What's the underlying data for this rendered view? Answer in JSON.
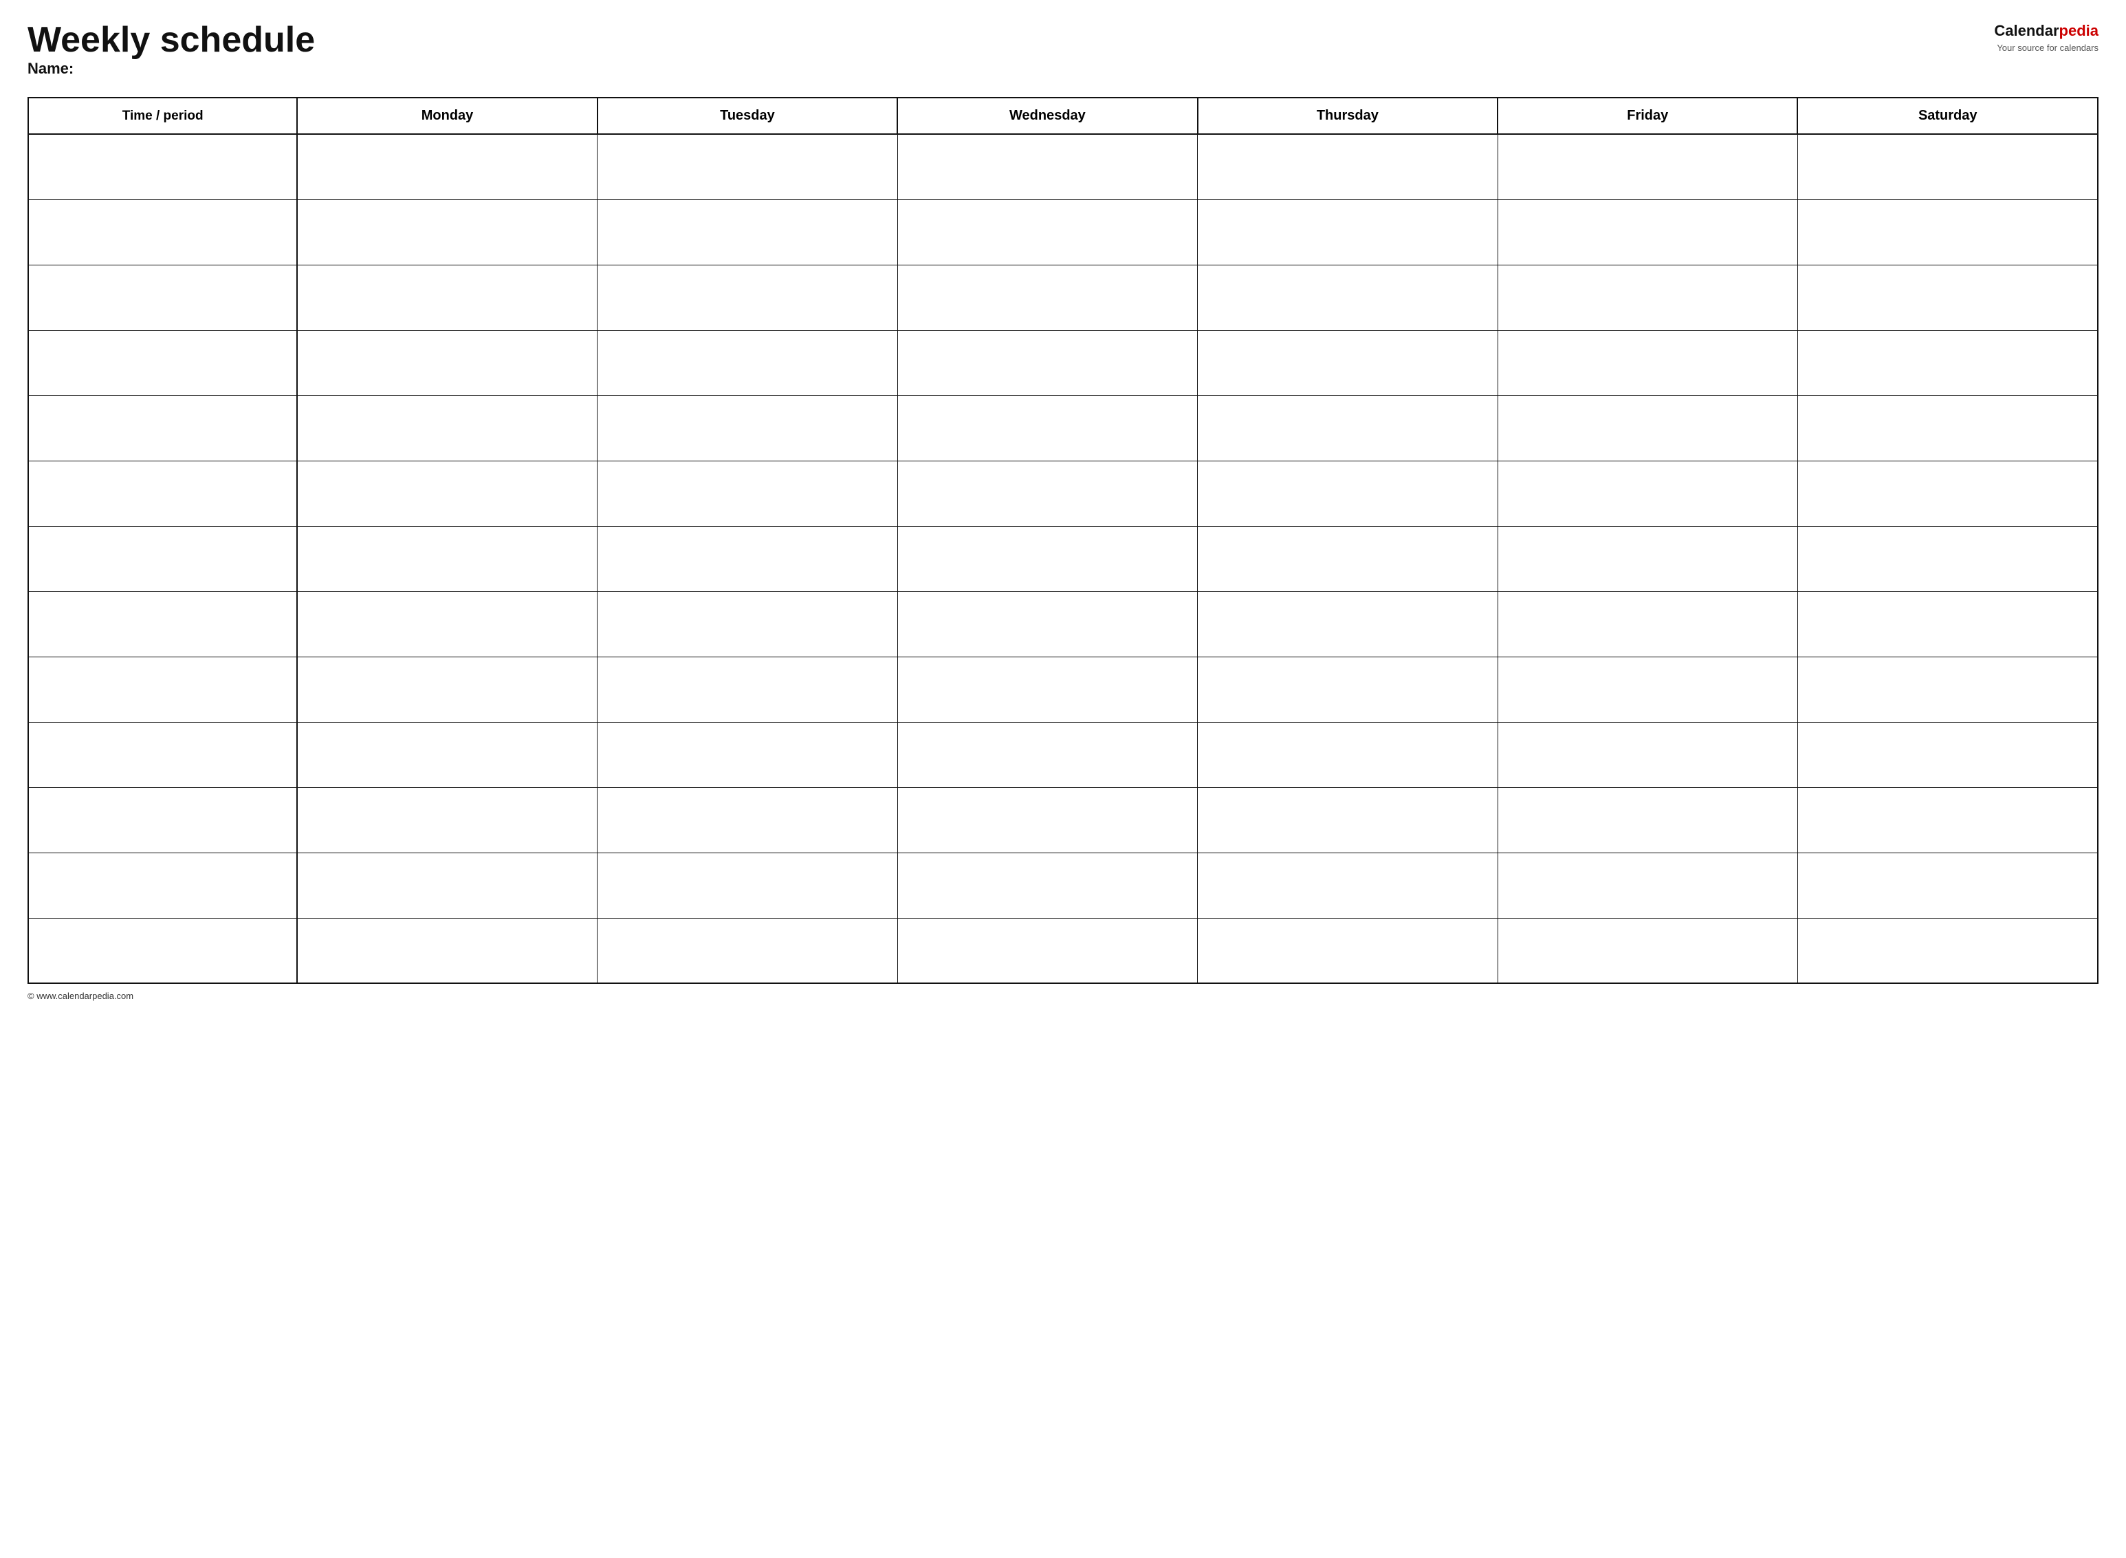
{
  "header": {
    "title": "Weekly schedule",
    "logo": {
      "calendar_text": "Calendar",
      "pedia_text": "pedia",
      "tagline": "Your source for calendars"
    },
    "name_label": "Name:"
  },
  "table": {
    "columns": [
      {
        "key": "time",
        "label": "Time / period"
      },
      {
        "key": "monday",
        "label": "Monday"
      },
      {
        "key": "tuesday",
        "label": "Tuesday"
      },
      {
        "key": "wednesday",
        "label": "Wednesday"
      },
      {
        "key": "thursday",
        "label": "Thursday"
      },
      {
        "key": "friday",
        "label": "Friday"
      },
      {
        "key": "saturday",
        "label": "Saturday"
      }
    ],
    "row_count": 13
  },
  "footer": {
    "copyright": "© www.calendarpedia.com"
  }
}
